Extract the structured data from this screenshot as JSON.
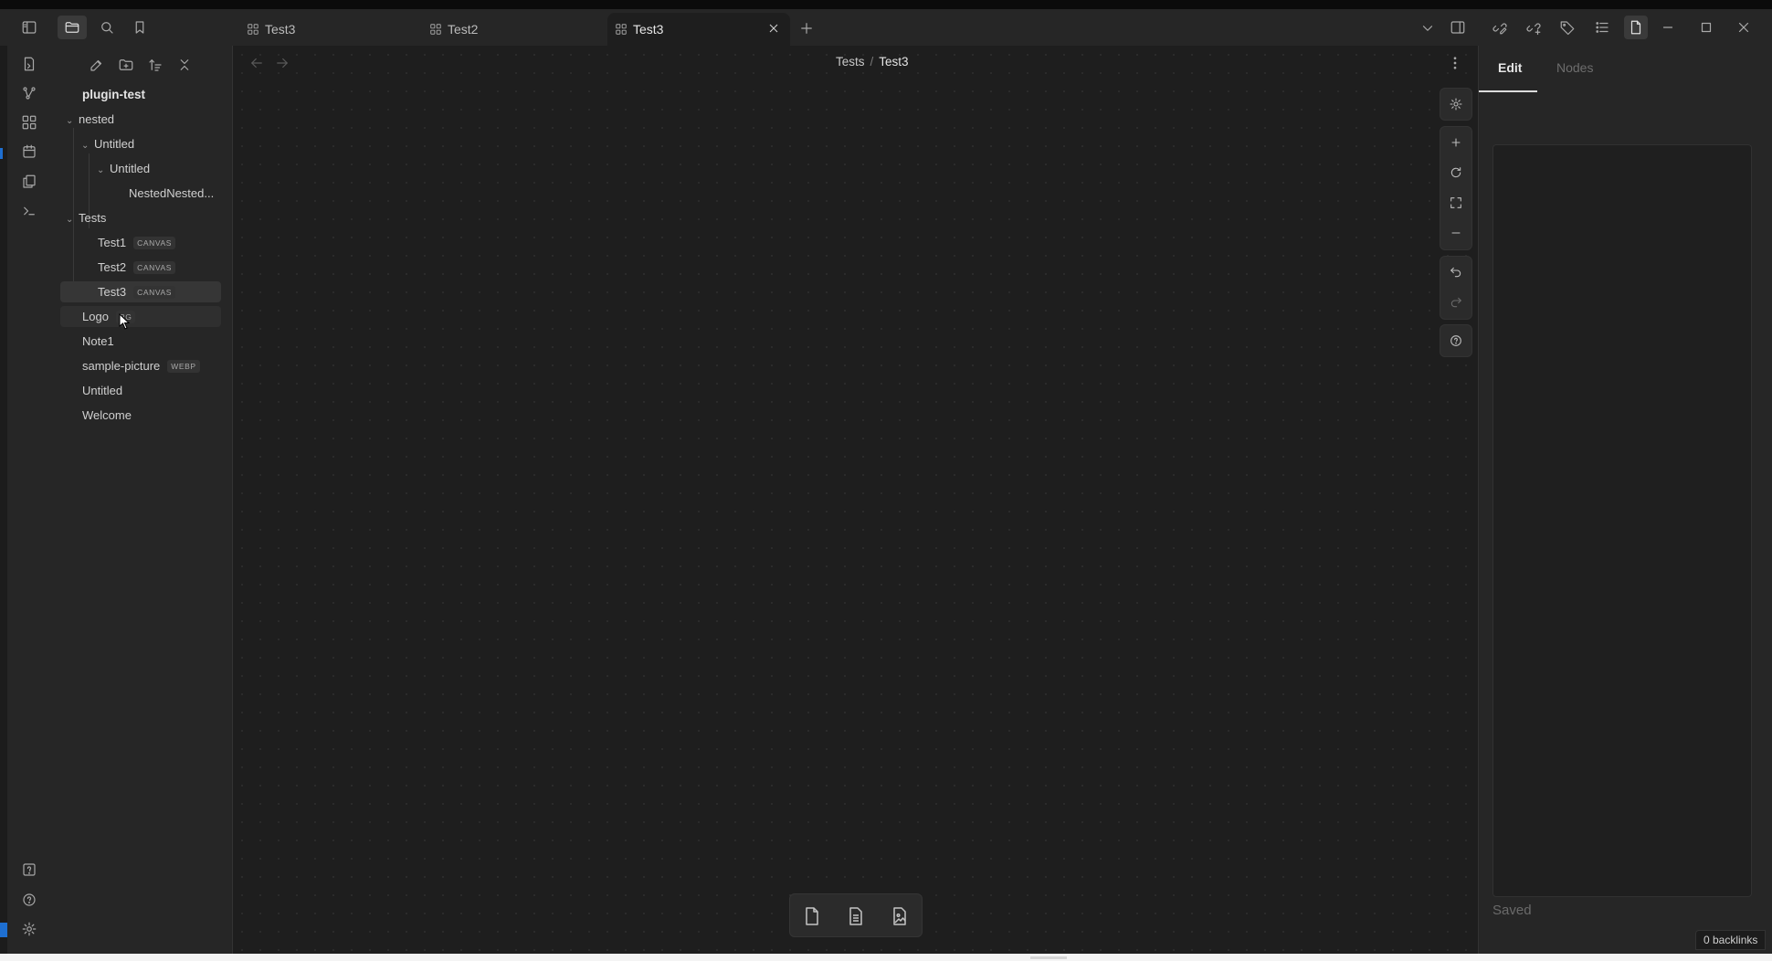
{
  "tabs": [
    {
      "label": "Test3",
      "icon": "canvas-icon"
    },
    {
      "label": "Test2",
      "icon": "canvas-icon"
    },
    {
      "label": "Test3",
      "icon": "canvas-icon",
      "active": true
    }
  ],
  "vault": {
    "name": "plugin-test"
  },
  "file_tree": [
    {
      "label": "nested",
      "type": "folder",
      "expanded": true
    },
    {
      "label": "Untitled",
      "type": "folder",
      "expanded": true
    },
    {
      "label": "Untitled",
      "type": "folder",
      "expanded": true
    },
    {
      "label": "NestedNested...",
      "type": "file"
    },
    {
      "label": "Tests",
      "type": "folder",
      "expanded": true
    },
    {
      "label": "Test1",
      "badge": "CANVAS"
    },
    {
      "label": "Test2",
      "badge": "CANVAS"
    },
    {
      "label": "Test3",
      "badge": "CANVAS",
      "selected": true
    },
    {
      "label": "Logo",
      "badge": "PG",
      "hovered": true
    },
    {
      "label": "Note1"
    },
    {
      "label": "sample-picture",
      "badge": "WEBP"
    },
    {
      "label": "Untitled"
    },
    {
      "label": "Welcome"
    }
  ],
  "breadcrumb": {
    "parent": "Tests",
    "separator": "/",
    "current": "Test3"
  },
  "right_panel": {
    "tabs": [
      {
        "label": "Edit",
        "active": true
      },
      {
        "label": "Nodes"
      }
    ],
    "status": "Saved",
    "backlinks": "0 backlinks"
  },
  "colors": {
    "background": "#1e1e1e",
    "panel": "#262626",
    "accent": "#1e6fd1"
  }
}
